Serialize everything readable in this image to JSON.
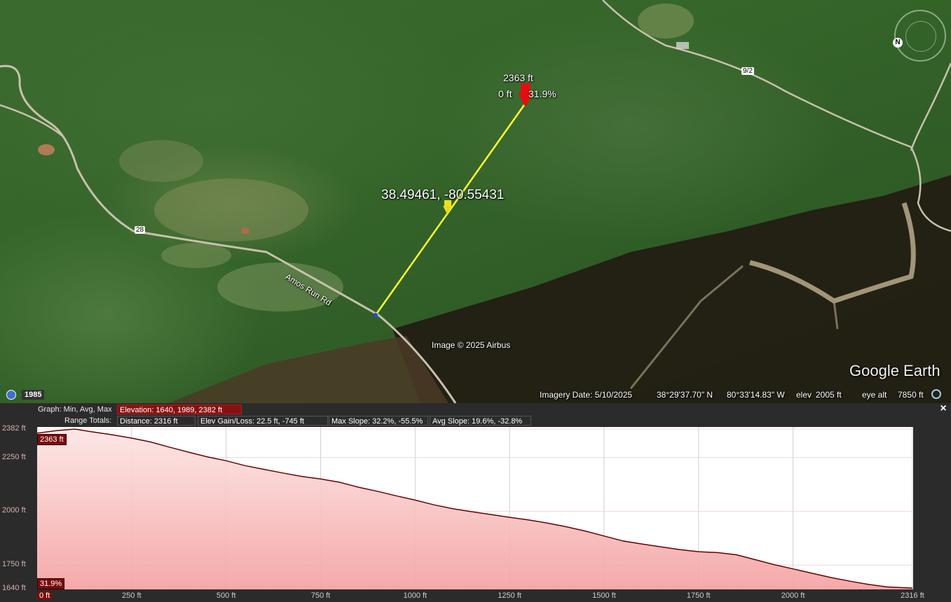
{
  "map": {
    "road_label": "Amos Run Rd",
    "route_marker_28": "28",
    "route_marker_9_2": "9/2",
    "placemark_coords": "38.49461, -80.55431",
    "marker_elev": "2363 ft",
    "marker_dist": "0 ft",
    "marker_slope": "31.9%",
    "attribution": "Image © 2025 Airbus",
    "logo": "Google Earth",
    "historical_year": "1985",
    "compass_label": "N",
    "status": {
      "imagery_date": "Imagery Date: 5/10/2025",
      "lat": "38°29'37.70\" N",
      "lon": "80°33'14.83\" W",
      "elev_label": "elev",
      "elev_value": "2005 ft",
      "eye_alt_label": "eye alt",
      "eye_alt_value": "7850 ft"
    }
  },
  "profile": {
    "graph_label": "Graph: Min, Avg, Max",
    "elevation_stat": "Elevation: 1640, 1989, 2382 ft",
    "range_label": "Range Totals:",
    "distance_stat": "Distance: 2316 ft",
    "gain_loss_stat": "Elev Gain/Loss: 22.5 ft, -745 ft",
    "max_slope_stat": "Max Slope: 32.2%, -55.5%",
    "avg_slope_stat": "Avg Slope: 19.6%, -32.8%",
    "close_label": "×",
    "top_tag": "2363 ft",
    "bottom_tag": "31.9%"
  },
  "chart_data": {
    "type": "area",
    "xlabel": "",
    "ylabel": "",
    "x_ticks": [
      "0 ft",
      "250 ft",
      "500 ft",
      "750 ft",
      "1000 ft",
      "1250 ft",
      "1500 ft",
      "1750 ft",
      "2000 ft",
      "2316 ft"
    ],
    "y_ticks": [
      "2382 ft",
      "2250 ft",
      "2000 ft",
      "1750 ft",
      "1640 ft"
    ],
    "xlim": [
      0,
      2316
    ],
    "ylim": [
      1640,
      2382
    ],
    "grid": true,
    "fill_color": "#f4a0a0",
    "line_color": "#6b0000",
    "series": [
      {
        "x": [
          0,
          50,
          100,
          150,
          200,
          250,
          300,
          350,
          400,
          450,
          500,
          550,
          600,
          650,
          700,
          750,
          800,
          850,
          900,
          950,
          1000,
          1050,
          1100,
          1150,
          1200,
          1250,
          1300,
          1350,
          1400,
          1450,
          1500,
          1550,
          1600,
          1650,
          1700,
          1750,
          1800,
          1850,
          1900,
          1950,
          2000,
          2050,
          2100,
          2150,
          2200,
          2250,
          2316
        ],
        "y": [
          2363,
          2375,
          2382,
          2368,
          2355,
          2340,
          2322,
          2298,
          2275,
          2253,
          2235,
          2212,
          2195,
          2178,
          2162,
          2150,
          2135,
          2112,
          2093,
          2072,
          2052,
          2030,
          2012,
          1998,
          1985,
          1972,
          1960,
          1945,
          1928,
          1908,
          1885,
          1862,
          1848,
          1835,
          1822,
          1812,
          1808,
          1798,
          1775,
          1752,
          1732,
          1712,
          1692,
          1675,
          1660,
          1648,
          1643
        ]
      }
    ]
  }
}
